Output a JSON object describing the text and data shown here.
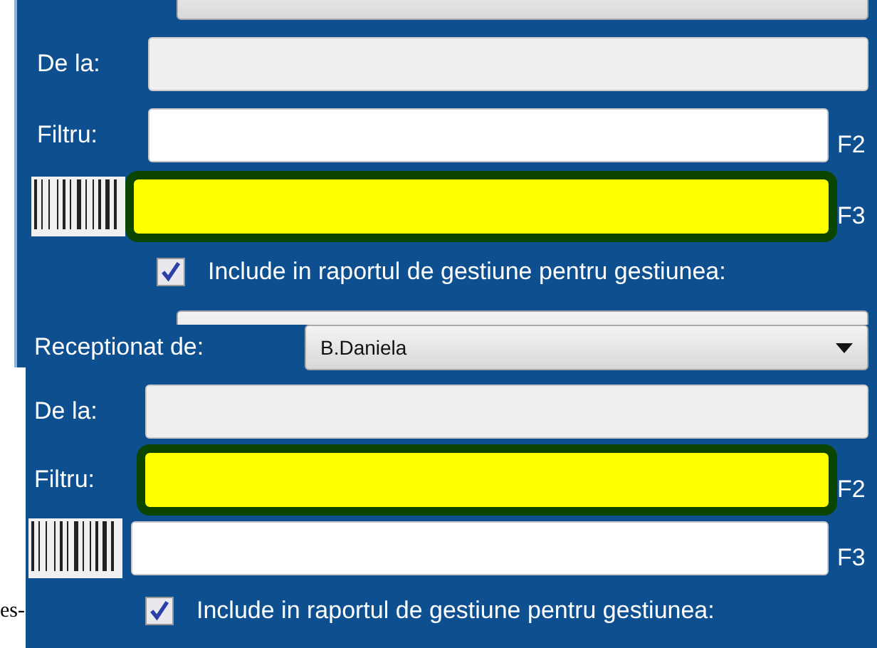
{
  "page_text": "es-",
  "panels": [
    {
      "rows": [
        {
          "kind": "combo"
        },
        {
          "kind": "field",
          "label": "De la:",
          "disabled": true,
          "highlighted": false
        },
        {
          "kind": "field",
          "label": "Filtru:",
          "disabled": false,
          "highlighted": false,
          "key": "F2"
        },
        {
          "kind": "barcode",
          "disabled": false,
          "highlighted": true,
          "key": "F3"
        },
        {
          "kind": "checkbox",
          "label": "Include in raportul de gestiune pentru gestiunea:",
          "checked": true
        },
        {
          "kind": "combo"
        }
      ]
    },
    {
      "rows": [
        {
          "kind": "combo",
          "label": "Receptionat de:",
          "value": "B.Daniela"
        },
        {
          "kind": "field",
          "label": "De la:",
          "disabled": true,
          "highlighted": false
        },
        {
          "kind": "field",
          "label": "Filtru:",
          "disabled": false,
          "highlighted": true,
          "key": "F2"
        },
        {
          "kind": "barcode",
          "disabled": false,
          "highlighted": false,
          "key": "F3"
        },
        {
          "kind": "checkbox",
          "label": "Include in raportul de gestiune pentru gestiunea:",
          "checked": true
        }
      ]
    }
  ]
}
